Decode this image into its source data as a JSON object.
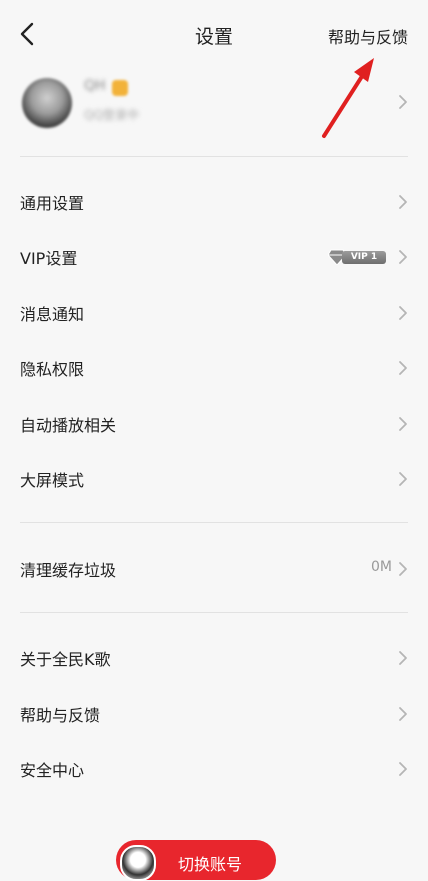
{
  "header": {
    "title": "设置",
    "help_link": "帮助与反馈"
  },
  "profile": {
    "nickname": "QH",
    "subtitle": "QQ登录中"
  },
  "menu": {
    "general": "通用设置",
    "vip": "VIP设置",
    "vip_badge": "VIP 1",
    "notifications": "消息通知",
    "privacy": "隐私权限",
    "autoplay": "自动播放相关",
    "bigscreen": "大屏模式",
    "clear_cache": "清理缓存垃圾",
    "cache_size": "0M",
    "about": "关于全民K歌",
    "help": "帮助与反馈",
    "security": "安全中心"
  },
  "footer": {
    "switch_account": "切换账号"
  },
  "colors": {
    "accent": "#e8262d",
    "annotation_arrow": "#e02020"
  }
}
